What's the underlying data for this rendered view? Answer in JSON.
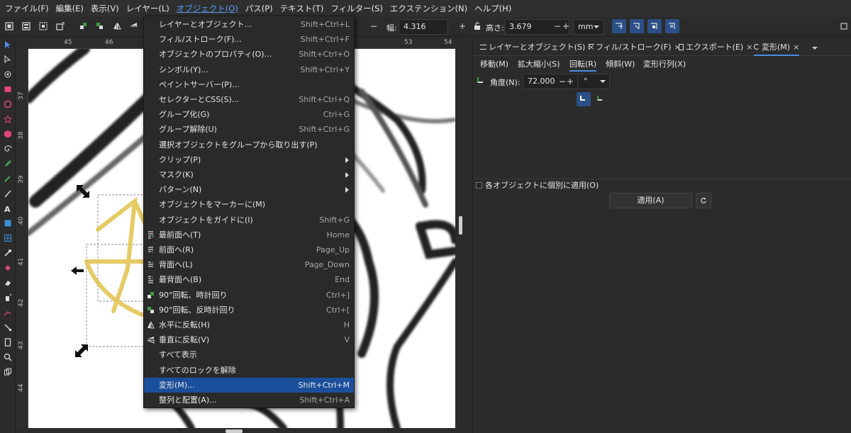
{
  "menubar": {
    "items": [
      {
        "label": "ファイル(F)"
      },
      {
        "label": "編集(E)"
      },
      {
        "label": "表示(V)"
      },
      {
        "label": "レイヤー(L)"
      },
      {
        "label": "オブジェクト(O)"
      },
      {
        "label": "パス(P)"
      },
      {
        "label": "テキスト(T)"
      },
      {
        "label": "フィルター(S)"
      },
      {
        "label": "エクステンション(N)"
      },
      {
        "label": "ヘルプ(H)"
      }
    ],
    "active_index": 4
  },
  "toolbar": {
    "width_label": "幅:",
    "width_value": "4.316",
    "height_label": "高さ:",
    "height_value": "3.679",
    "unit": "mm",
    "plus": "+",
    "minus": "−"
  },
  "rulers": {
    "top": [
      "45",
      "46",
      "53",
      "54"
    ],
    "left": [
      "37",
      "38",
      "39",
      "40",
      "41",
      "42",
      "43",
      "44"
    ]
  },
  "object_menu": {
    "items": [
      {
        "label": "レイヤーとオブジェクト...",
        "shortcut": "Shift+Ctrl+L",
        "icon": ""
      },
      {
        "label": "フィル/ストローク(F)...",
        "shortcut": "Shift+Ctrl+F",
        "icon": ""
      },
      {
        "label": "オブジェクトのプロパティ(O)...",
        "shortcut": "Shift+Ctrl+O",
        "icon": ""
      },
      {
        "label": "シンボル(Y)...",
        "shortcut": "Shift+Ctrl+Y",
        "icon": ""
      },
      {
        "label": "ペイントサーバー(P)...",
        "shortcut": "",
        "icon": ""
      },
      {
        "label": "セレクターとCSS(S)...",
        "shortcut": "Shift+Ctrl+Q",
        "icon": ""
      },
      {
        "label": "グループ化(G)",
        "shortcut": "Ctrl+G",
        "icon": ""
      },
      {
        "label": "グループ解除(U)",
        "shortcut": "Shift+Ctrl+G",
        "icon": ""
      },
      {
        "label": "選択オブジェクトをグループから取り出す(P)",
        "shortcut": "",
        "icon": ""
      },
      {
        "label": "クリップ(P)",
        "shortcut": "",
        "icon": "",
        "submenu": true
      },
      {
        "label": "マスク(K)",
        "shortcut": "",
        "icon": "",
        "submenu": true
      },
      {
        "label": "パターン(N)",
        "shortcut": "",
        "icon": "",
        "submenu": true
      },
      {
        "label": "オブジェクトをマーカーに(M)",
        "shortcut": "",
        "icon": ""
      },
      {
        "label": "オブジェクトをガイドに(I)",
        "shortcut": "Shift+G",
        "icon": ""
      },
      {
        "label": "最前面へ(T)",
        "shortcut": "Home",
        "icon": "raise-to-top-icon"
      },
      {
        "label": "前面へ(R)",
        "shortcut": "Page_Up",
        "icon": "raise-icon"
      },
      {
        "label": "背面へ(L)",
        "shortcut": "Page_Down",
        "icon": "lower-icon"
      },
      {
        "label": "最背面へ(B)",
        "shortcut": "End",
        "icon": "lower-to-bottom-icon"
      },
      {
        "label": "90°回転、時計回り",
        "shortcut": "Ctrl+]",
        "icon": "rotate-cw-icon"
      },
      {
        "label": "90°回転、反時計回り",
        "shortcut": "Ctrl+[",
        "icon": "rotate-ccw-icon"
      },
      {
        "label": "水平に反転(H)",
        "shortcut": "H",
        "icon": "flip-horizontal-icon"
      },
      {
        "label": "垂直に反転(V)",
        "shortcut": "V",
        "icon": "flip-vertical-icon"
      },
      {
        "label": "すべて表示",
        "shortcut": "",
        "icon": ""
      },
      {
        "label": "すべてのロックを解除",
        "shortcut": "",
        "icon": ""
      },
      {
        "label": "変形(M)...",
        "shortcut": "Shift+Ctrl+M",
        "icon": "",
        "highlighted": true
      },
      {
        "label": "整列と配置(A)...",
        "shortcut": "Shift+Ctrl+A",
        "icon": ""
      }
    ]
  },
  "dock": {
    "tabs": [
      {
        "label": "レイヤーとオブジェクト(S)"
      },
      {
        "label": "フィル/ストローク(F)"
      },
      {
        "label": "エクスポート(E)"
      },
      {
        "label": "変形(M)",
        "active": true
      }
    ],
    "close_glyph": "×",
    "sub_tabs": [
      {
        "label": "移動(M)"
      },
      {
        "label": "拡大縮小(S)"
      },
      {
        "label": "回転(R)",
        "active": true
      },
      {
        "label": "傾斜(W)"
      },
      {
        "label": "変形行列(X)"
      }
    ],
    "angle_label": "角度(N):",
    "angle_value": "72.000",
    "angle_unit": "°",
    "apply_each_label": "各オブジェクトに個別に適用(O)",
    "apply_label": "適用(A)"
  },
  "colors": {
    "highlight": "#1b4f9b",
    "accent": "#4a8ae0",
    "menu_active_text": "#5b9bf0",
    "selection_stroke": "#e2c14a"
  }
}
